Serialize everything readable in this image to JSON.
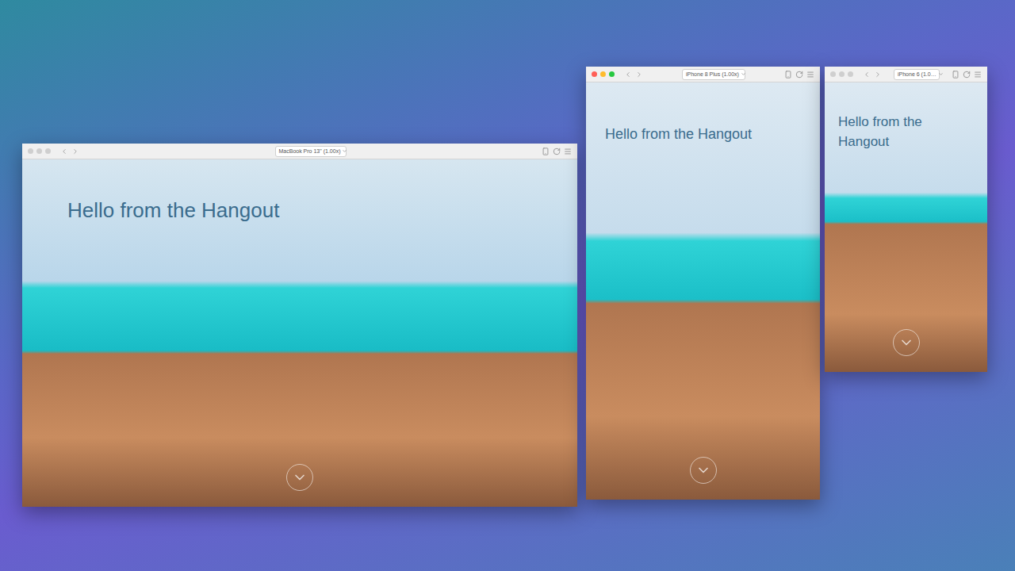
{
  "windows": [
    {
      "device": "MacBook Pro 13\" (1.00x)",
      "heading": "Hello from the Hangout",
      "active": false
    },
    {
      "device": "iPhone 8 Plus (1.00x)",
      "heading": "Hello from the Hangout",
      "active": true
    },
    {
      "device": "iPhone 6 (1.0…",
      "heading": "Hello from the Hangout",
      "active": false
    }
  ]
}
